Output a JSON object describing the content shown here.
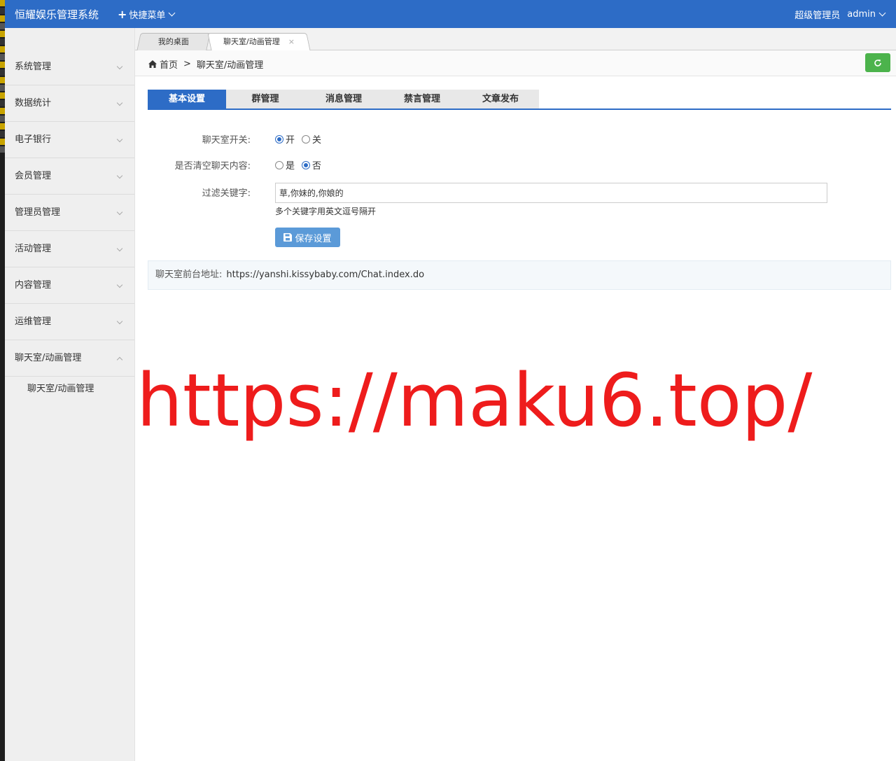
{
  "header": {
    "brand": "恒耀娱乐管理系统",
    "quick_menu": "快捷菜单",
    "user_role": "超级管理员",
    "user_name": "admin"
  },
  "colors": {
    "primary": "#2d6cc6",
    "success": "#4cb34c",
    "watermark": "#ee1c1c"
  },
  "sidebar": {
    "items": [
      {
        "label": "系统管理"
      },
      {
        "label": "数据统计"
      },
      {
        "label": "电子银行"
      },
      {
        "label": "会员管理"
      },
      {
        "label": "管理员管理"
      },
      {
        "label": "活动管理"
      },
      {
        "label": "内容管理"
      },
      {
        "label": "运维管理"
      },
      {
        "label": "聊天室/动画管理"
      }
    ],
    "submenu": [
      {
        "label": "聊天室/动画管理"
      }
    ]
  },
  "tabs": [
    {
      "label": "我的桌面"
    },
    {
      "label": "聊天室/动画管理",
      "close": "×"
    }
  ],
  "breadcrumb": {
    "home": "首页",
    "separator": ">",
    "current": "聊天室/动画管理"
  },
  "subtabs": [
    {
      "label": "基本设置"
    },
    {
      "label": "群管理"
    },
    {
      "label": "消息管理"
    },
    {
      "label": "禁言管理"
    },
    {
      "label": "文章发布"
    }
  ],
  "form": {
    "chat_switch": {
      "label": "聊天室开关:",
      "on_label": "开",
      "off_label": "关",
      "selected": "开"
    },
    "clear_content": {
      "label": "是否清空聊天内容:",
      "yes_label": "是",
      "no_label": "否",
      "selected": "否"
    },
    "keywords": {
      "label": "过滤关键字:",
      "value": "草,你妹的,你娘的",
      "hint": "多个关键字用英文逗号隔开"
    },
    "save_label": "保存设置"
  },
  "address": {
    "label": "聊天室前台地址:",
    "url": "https://yanshi.kissybaby.com/Chat.index.do"
  },
  "watermark": "https://maku6.top/"
}
